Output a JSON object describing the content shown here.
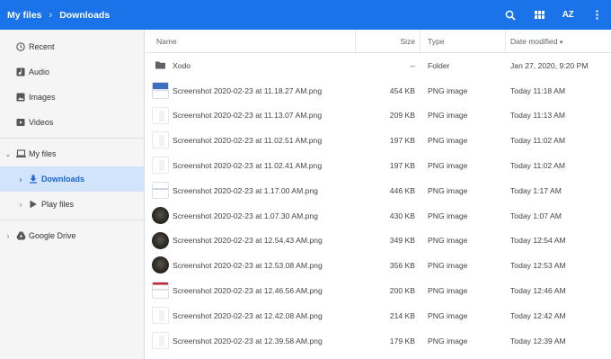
{
  "breadcrumb": {
    "root": "My files",
    "current": "Downloads"
  },
  "toolbar": {
    "sort_label": "AZ"
  },
  "sidebar": {
    "items": [
      {
        "label": "Recent",
        "icon": "clock-icon"
      },
      {
        "label": "Audio",
        "icon": "audio-icon"
      },
      {
        "label": "Images",
        "icon": "image-icon"
      },
      {
        "label": "Videos",
        "icon": "video-icon"
      },
      {
        "label": "My files",
        "icon": "laptop-icon"
      },
      {
        "label": "Downloads",
        "icon": "download-icon"
      },
      {
        "label": "Play files",
        "icon": "play-icon"
      },
      {
        "label": "Google Drive",
        "icon": "drive-icon"
      }
    ]
  },
  "columns": {
    "name": "Name",
    "size": "Size",
    "type": "Type",
    "date": "Date modified"
  },
  "files": [
    {
      "name": "Xodo",
      "size": "--",
      "type": "Folder",
      "date": "Jan 27, 2020, 9:20 PM",
      "thumb": "folder"
    },
    {
      "name": "Screenshot 2020-02-23 at 11.18.27 AM.png",
      "size": "454 KB",
      "type": "PNG image",
      "date": "Today 11:18 AM",
      "thumb": "blue"
    },
    {
      "name": "Screenshot 2020-02-23 at 11.13.07 AM.png",
      "size": "209 KB",
      "type": "PNG image",
      "date": "Today 11:13 AM",
      "thumb": "white"
    },
    {
      "name": "Screenshot 2020-02-23 at 11.02.51 AM.png",
      "size": "197 KB",
      "type": "PNG image",
      "date": "Today 11:02 AM",
      "thumb": "white"
    },
    {
      "name": "Screenshot 2020-02-23 at 11.02.41 AM.png",
      "size": "197 KB",
      "type": "PNG image",
      "date": "Today 11:02 AM",
      "thumb": "white"
    },
    {
      "name": "Screenshot 2020-02-23 at 1.17.00 AM.png",
      "size": "446 KB",
      "type": "PNG image",
      "date": "Today 1:17 AM",
      "thumb": "stripe"
    },
    {
      "name": "Screenshot 2020-02-23 at 1.07.30 AM.png",
      "size": "430 KB",
      "type": "PNG image",
      "date": "Today 1:07 AM",
      "thumb": "dark"
    },
    {
      "name": "Screenshot 2020-02-23 at 12.54.43 AM.png",
      "size": "349 KB",
      "type": "PNG image",
      "date": "Today 12:54 AM",
      "thumb": "dark"
    },
    {
      "name": "Screenshot 2020-02-23 at 12.53.08 AM.png",
      "size": "356 KB",
      "type": "PNG image",
      "date": "Today 12:53 AM",
      "thumb": "dark"
    },
    {
      "name": "Screenshot 2020-02-23 at 12.46.56 AM.png",
      "size": "200 KB",
      "type": "PNG image",
      "date": "Today 12:46 AM",
      "thumb": "redtop"
    },
    {
      "name": "Screenshot 2020-02-23 at 12.42.08 AM.png",
      "size": "214 KB",
      "type": "PNG image",
      "date": "Today 12:42 AM",
      "thumb": "white"
    },
    {
      "name": "Screenshot 2020-02-23 at 12.39.58 AM.png",
      "size": "179 KB",
      "type": "PNG image",
      "date": "Today 12:39 AM",
      "thumb": "white"
    }
  ]
}
